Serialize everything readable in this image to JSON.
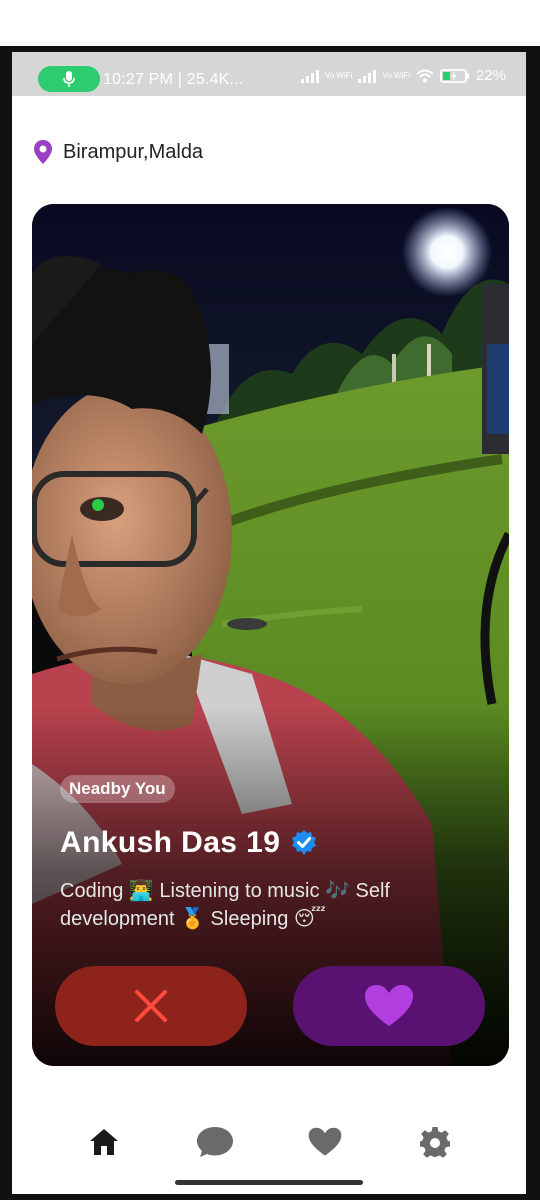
{
  "status_bar": {
    "time_text": "10:27 PM | 25.4K...",
    "battery_percent": "22%",
    "signal_labels": [
      "Vo WiFi",
      "Vo WiFi"
    ],
    "mic_pill_color": "#2ecc71"
  },
  "location": {
    "icon": "location-pin-icon",
    "text": "Birampur,Malda",
    "icon_color": "#9b3fc4"
  },
  "profile_card": {
    "badge": "Neadby You",
    "name_age": "Ankush Das 19",
    "verified_icon": "verified-badge-icon",
    "verified_color": "#1d8bf0",
    "bio": "Coding 👨‍💻 Listening to music 🎶 Self development 🏅 Sleeping 😴"
  },
  "actions": {
    "reject_icon": "close-icon",
    "reject_color": "#8e231c",
    "reject_icon_color": "#ff4a3d",
    "like_icon": "heart-icon",
    "like_color": "#5a1272",
    "like_icon_color": "#b23ee0"
  },
  "bottom_nav": {
    "items": [
      {
        "icon": "home-icon",
        "active": true
      },
      {
        "icon": "chat-icon",
        "active": false
      },
      {
        "icon": "heart-icon",
        "active": false
      },
      {
        "icon": "settings-gear-icon",
        "active": false
      }
    ]
  }
}
